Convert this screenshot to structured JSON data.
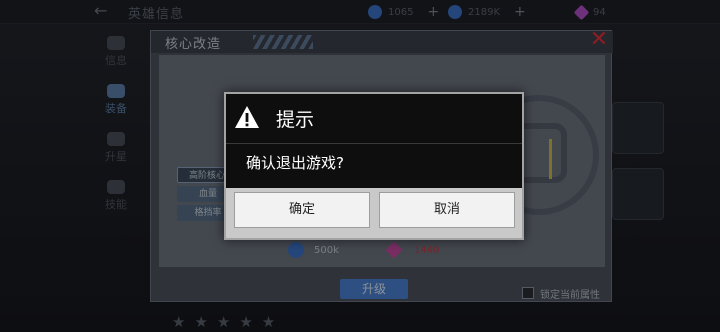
{
  "top_bar": {
    "title": "英雄信息",
    "resources": [
      {
        "value": "1065",
        "icon": "blue-gem-icon",
        "color": "#3a72c7"
      },
      {
        "value": "2189K",
        "icon": "blue-gear-icon",
        "color": "#3a72c7"
      },
      {
        "value": "94",
        "icon": "purple-diamond-icon",
        "color": "#b04fc8"
      }
    ]
  },
  "left_nav": [
    {
      "label": "信息",
      "active": false
    },
    {
      "label": "装备",
      "active": true
    },
    {
      "label": "升星",
      "active": false
    },
    {
      "label": "技能",
      "active": false
    }
  ],
  "core_panel": {
    "title": "核心改造",
    "tags": [
      "高阶核心",
      "血量",
      "格挡率"
    ],
    "costs": [
      {
        "value": "500k",
        "icon": "gear-coin-icon",
        "color": "#3a72c7"
      },
      {
        "value": "1440",
        "icon": "purple-crystal-icon",
        "color": "#c93a43"
      }
    ],
    "upgrade_label": "升级",
    "lock_label": "锁定当前属性",
    "stars": "★★★★★"
  },
  "dialog": {
    "title": "提示",
    "message": "确认退出游戏?",
    "ok_label": "确定",
    "cancel_label": "取消"
  },
  "colors": {
    "dialog_bg": "#0e0e0f",
    "dialog_border": "#a3a3a3",
    "button_bg": "#f2f2f2",
    "accent_blue": "#4b80d2",
    "close_red": "#e0303a"
  }
}
